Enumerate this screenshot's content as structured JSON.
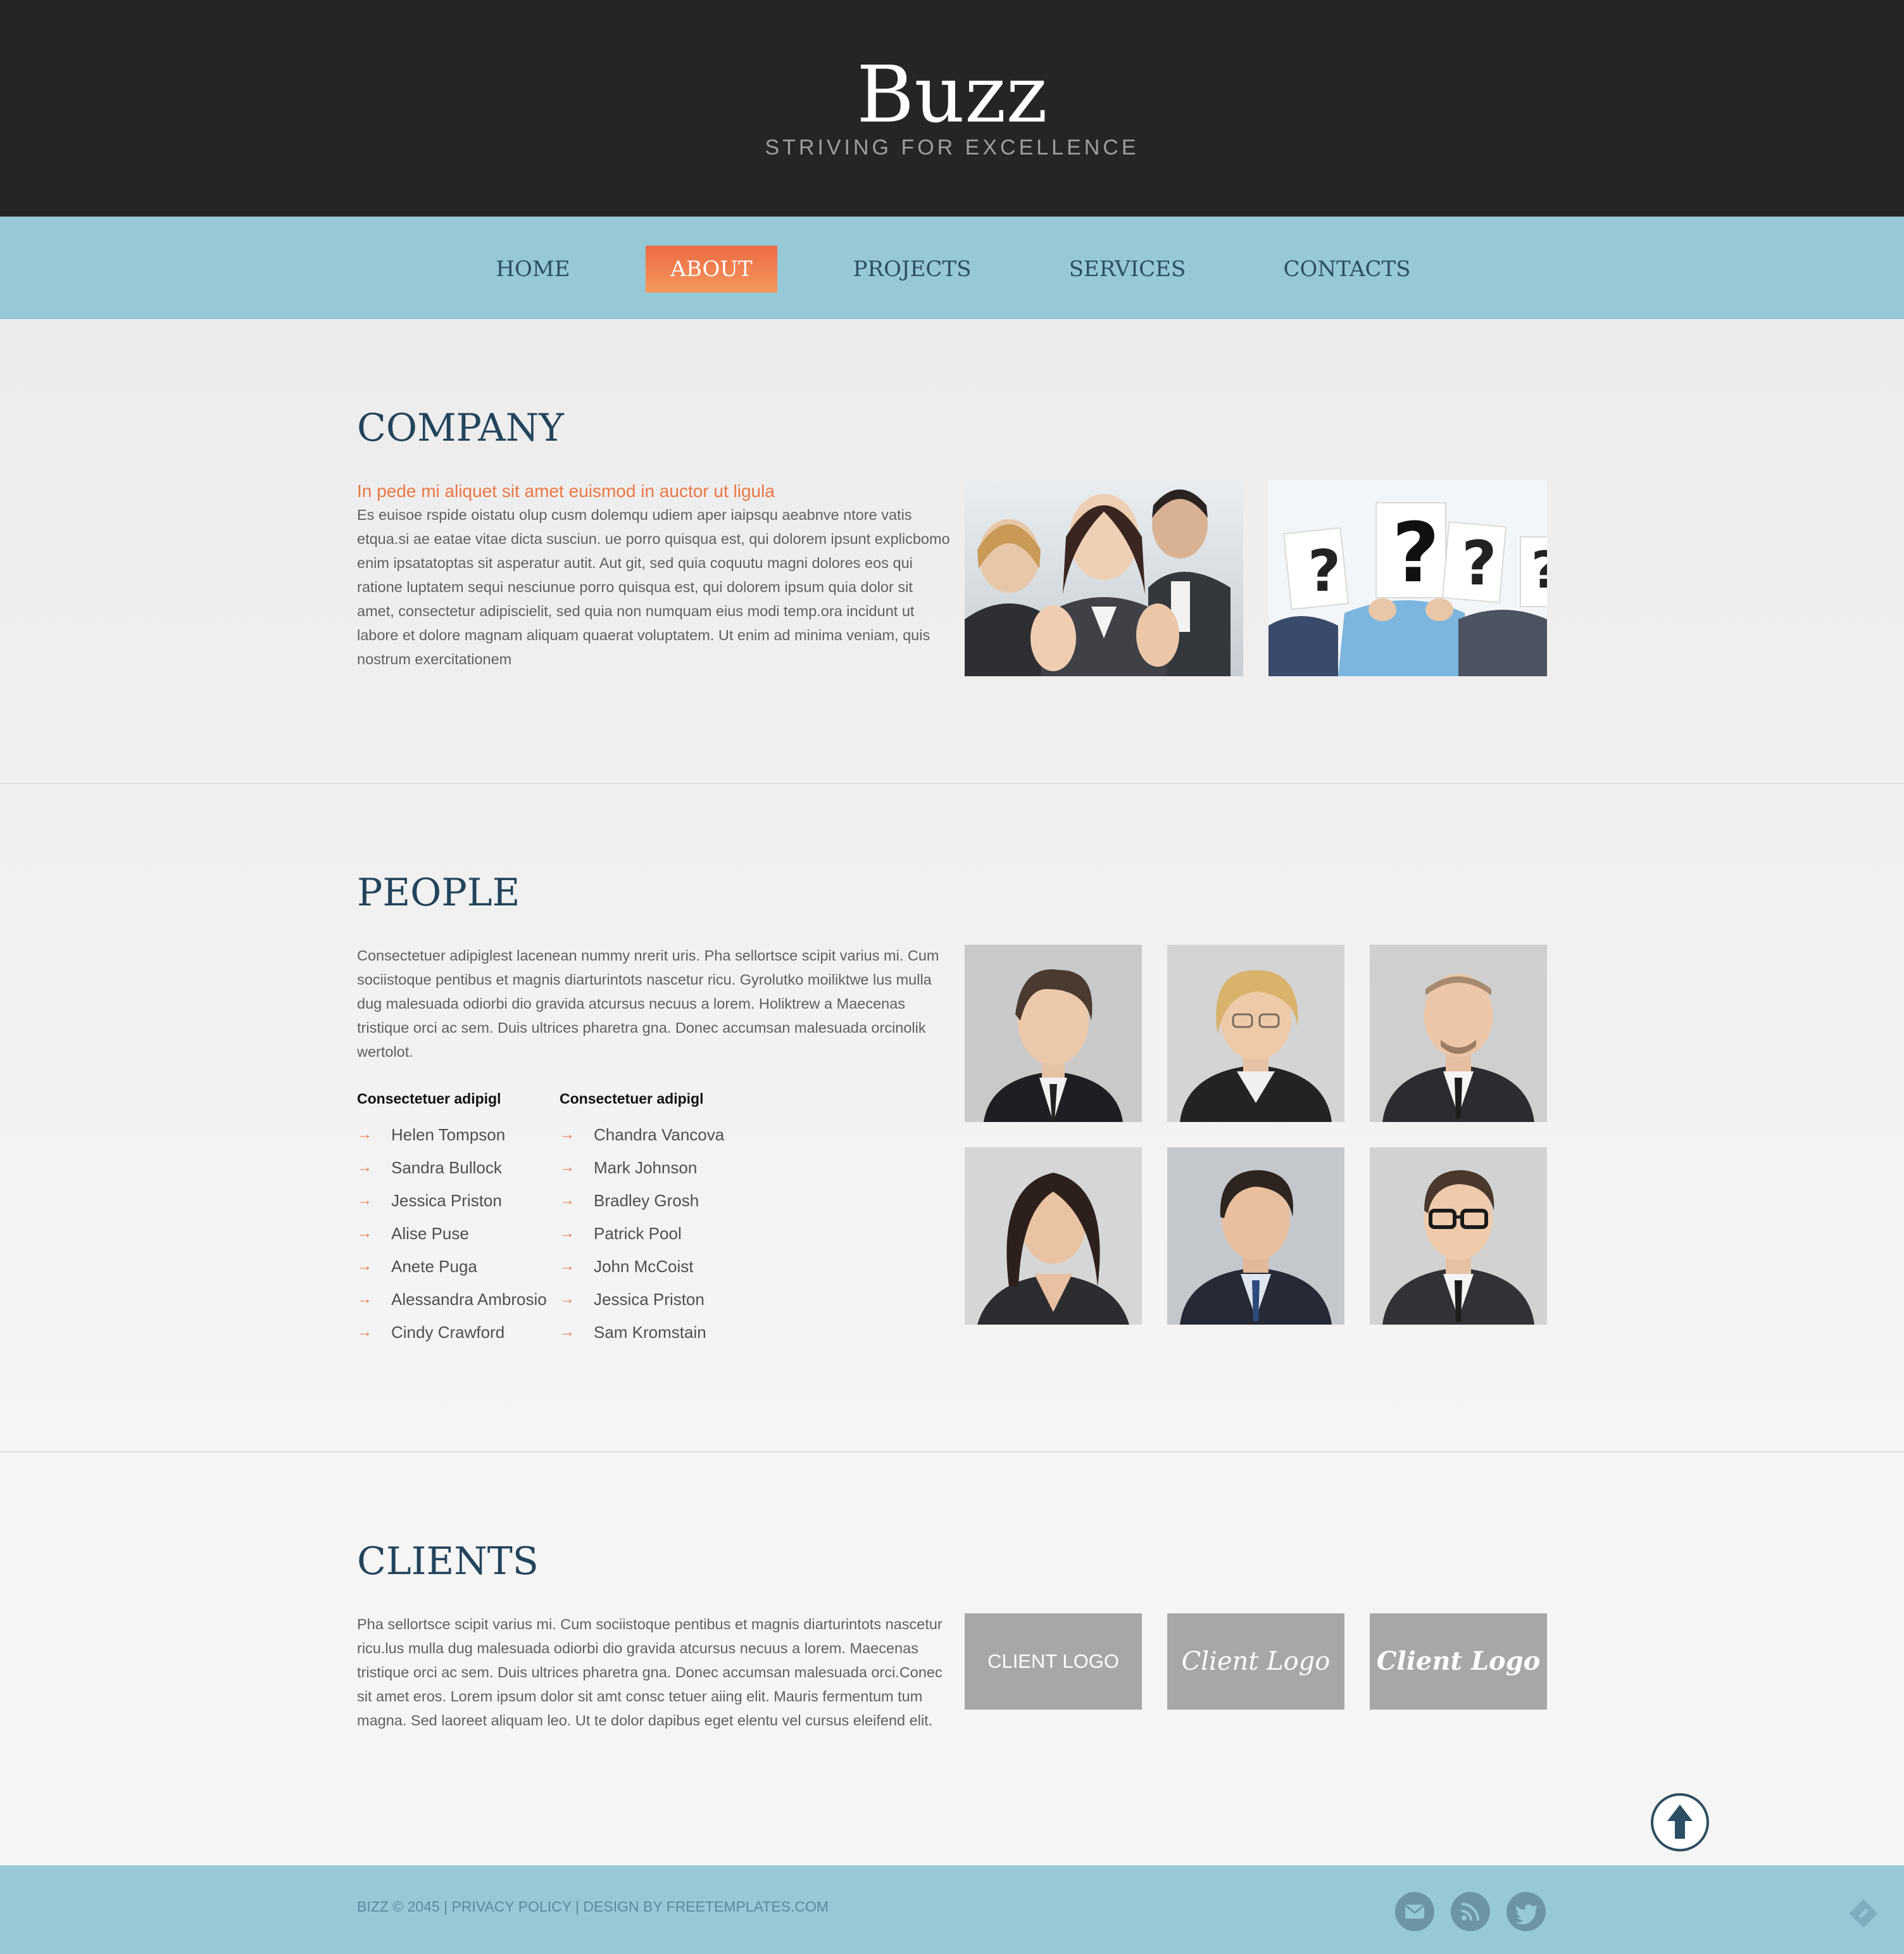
{
  "header": {
    "title": "Buzz",
    "tagline": "STRIVING FOR EXCELLENCE"
  },
  "nav": {
    "items": [
      {
        "label": "HOME"
      },
      {
        "label": "ABOUT",
        "active": true
      },
      {
        "label": "PROJECTS"
      },
      {
        "label": "SERVICES"
      },
      {
        "label": "CONTACTS"
      }
    ]
  },
  "company": {
    "heading": "COMPANY",
    "subtitle": "In pede mi aliquet sit amet euismod in auctor ut ligula",
    "text": "Es euisoe rspide oistatu olup cusm dolemqu udiem aper iaipsqu aeabnve ntore vatis etqua.si ae eatae vitae dicta susciun. ue porro quisqua est, qui dolorem ipsunt explicbomo enim ipsatatoptas sit asperatur autit. Aut git, sed quia coquutu magni dolores eos qui ratione luptatem sequi nesciunue porro quisqua est, qui dolorem ipsum quia dolor sit amet, consectetur adipiscielit, sed quia non numquam eius modi temp.ora incidunt ut labore et dolore magnam aliquam quaerat voluptatem. Ut enim ad minima veniam, quis nostrum exercitationem"
  },
  "people": {
    "heading": "PEOPLE",
    "text": "Consectetuer adipiglest lacenean nummy nrerit uris. Pha sellortsce scipit varius mi. Cum sociistoque pentibus et magnis diarturintots nascetur ricu. Gyrolutko moiliktwe lus mulla dug malesuada odiorbi dio gravida atcursus necuus a lorem. Holiktrew a Maecenas tristique orci ac sem. Duis ultrices pharetra gna. Donec accumsan malesuada orcinolik wertolot.",
    "list1": {
      "heading": "Consectetuer adipigl",
      "names": [
        "Helen Tompson",
        "Sandra Bullock",
        "Jessica Priston",
        "Alise Puse",
        "Anete Puga",
        "Alessandra Ambrosio",
        "Cindy Crawford"
      ]
    },
    "list2": {
      "heading": "Consectetuer adipigl",
      "names": [
        "Chandra Vancova",
        "Mark Johnson",
        "Bradley Grosh",
        "Patrick Pool",
        "John McCoist",
        "Jessica Priston",
        "Sam Kromstain"
      ]
    },
    "arrow": "→"
  },
  "clients": {
    "heading": "CLIENTS",
    "text": "Pha sellortsce scipit varius mi. Cum sociistoque pentibus et magnis diarturintots nascetur ricu.lus mulla dug malesuada odiorbi dio gravida atcursus necuus a lorem. Maecenas tristique orci ac sem. Duis ultrices pharetra gna. Donec accumsan malesuada orci.Conec sit amet eros. Lorem ipsum dolor sit amt consc tetuer aiing elit. Mauris fermentum tum magna. Sed laoreet aliquam leo. Ut te dolor dapibus eget elentu vel cursus eleifend elit.",
    "logos": [
      "CLIENT LOGO",
      "Client Logo",
      "Client Logo"
    ]
  },
  "footer": {
    "text": "BIZZ © 2045 | PRIVACY POLICY | DESIGN BY FREETEMPLATES.COM",
    "social": [
      "mail-icon",
      "rss-icon",
      "twitter-icon"
    ]
  },
  "colors": {
    "header_bg": "#252525",
    "nav_bg": "#96c8d6",
    "accent": "#ec6b43",
    "heading": "#22445c",
    "footer_text": "#5b8a9c"
  }
}
